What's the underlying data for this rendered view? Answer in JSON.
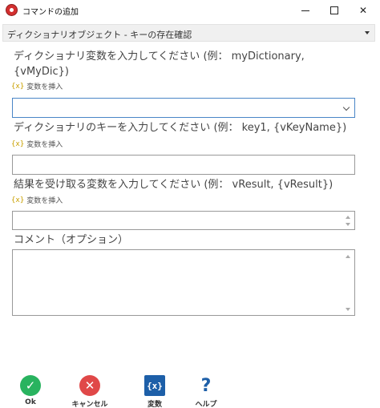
{
  "window": {
    "title": "コマンドの追加",
    "minimize_icon": "minimize-icon",
    "maximize_icon": "maximize-icon",
    "close_symbol": "✕"
  },
  "command": {
    "selected": "ディクショナリオブジェクト - キーの存在確認"
  },
  "fields": [
    {
      "label": "ディクショナリ変数を入力してください (例： myDictionary, {vMyDic})",
      "insert_label": "変数を挿入",
      "value": ""
    },
    {
      "label": "ディクショナリのキーを入力してください (例： key1, {vKeyName})",
      "insert_label": "変数を挿入",
      "value": ""
    },
    {
      "label": "結果を受け取る変数を入力してください (例： vResult, {vResult})",
      "insert_label": "変数を挿入",
      "value": ""
    }
  ],
  "comment": {
    "label": "コメント（オプション）",
    "value": ""
  },
  "insert_icon_glyph": "{x}",
  "actions": {
    "ok": "Ok",
    "cancel": "キャンセル",
    "variables": "変数",
    "help": "ヘルプ",
    "variables_glyph": "{x}",
    "help_glyph": "?",
    "ok_glyph": "✓",
    "cancel_glyph": "✕"
  },
  "colors": {
    "ok": "#29b35f",
    "cancel": "#e04848",
    "variables": "#1d5fa8",
    "focus_border": "#4a86c7"
  }
}
